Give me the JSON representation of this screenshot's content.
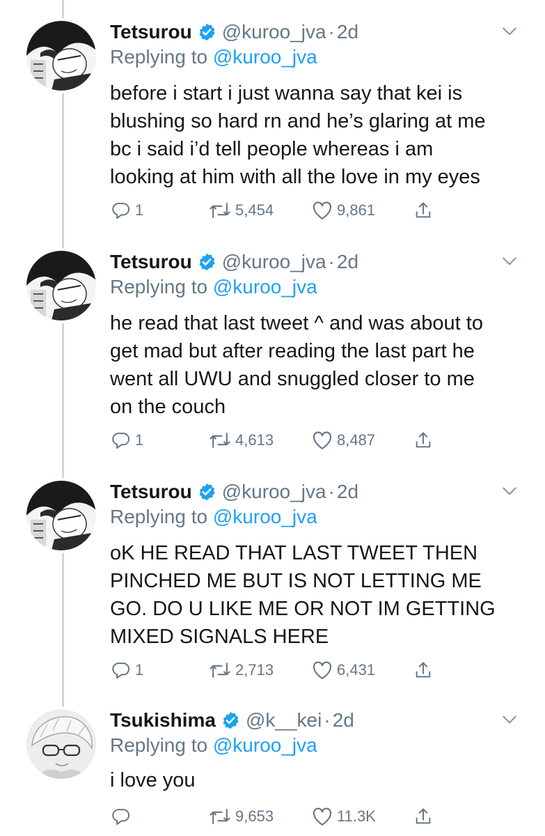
{
  "colors": {
    "accent": "#1da1f2",
    "muted": "#657786",
    "text": "#14171a",
    "thread": "#ccd6dd"
  },
  "tweets": [
    {
      "name": "Tetsurou",
      "verified": true,
      "handle": "@kuroo_jva",
      "time": "2d",
      "replying_prefix": "Replying to",
      "replying_to": "@kuroo_jva",
      "lines": [
        "before i start i just wanna say that kei is",
        "blushing so hard rn and he’s glaring at me",
        "bc i said i’d tell people whereas i am",
        "looking at him with all the love in my eyes"
      ],
      "replies": "1",
      "retweets": "5,454",
      "likes": "9,861",
      "avatar_icon": "avatar-dark-hair"
    },
    {
      "name": "Tetsurou",
      "verified": true,
      "handle": "@kuroo_jva",
      "time": "2d",
      "replying_prefix": "Replying to",
      "replying_to": "@kuroo_jva",
      "lines": [
        "he read that last tweet ^ and was about to",
        "get mad but after reading the last part he",
        "went all UWU and snuggled closer to me",
        "on the couch"
      ],
      "replies": "1",
      "retweets": "4,613",
      "likes": "8,487",
      "avatar_icon": "avatar-dark-hair"
    },
    {
      "name": "Tetsurou",
      "verified": true,
      "handle": "@kuroo_jva",
      "time": "2d",
      "replying_prefix": "Replying to",
      "replying_to": "@kuroo_jva",
      "lines": [
        "oK HE READ THAT LAST TWEET THEN",
        "PINCHED ME BUT IS NOT LETTING ME",
        "GO. DO U LIKE ME OR NOT IM GETTING",
        "MIXED SIGNALS HERE"
      ],
      "replies": "1",
      "retweets": "2,713",
      "likes": "6,431",
      "avatar_icon": "avatar-dark-hair"
    },
    {
      "name": "Tsukishima",
      "verified": true,
      "handle": "@k__kei",
      "time": "2d",
      "replying_prefix": "Replying to",
      "replying_to": "@kuroo_jva",
      "lines": [
        "i love you"
      ],
      "replies": "",
      "retweets": "9,653",
      "likes": "11.3K",
      "avatar_icon": "avatar-glasses"
    }
  ]
}
